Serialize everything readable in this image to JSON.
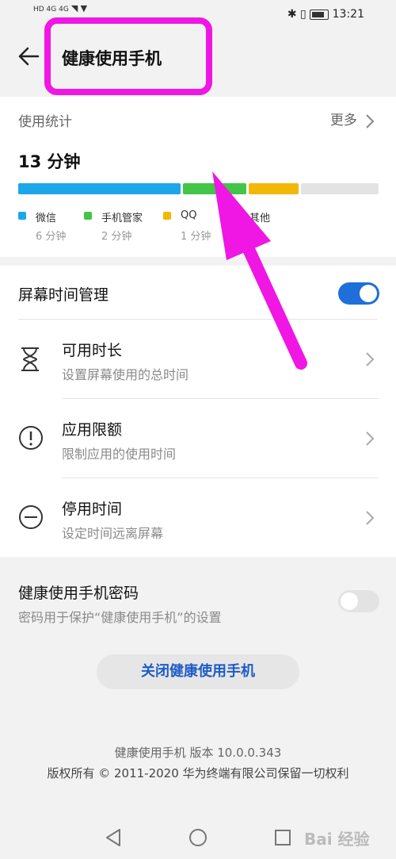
{
  "status": {
    "left_label": "HD 4G 4G",
    "time": "13:21"
  },
  "header": {
    "title": "健康使用手机"
  },
  "usage": {
    "section_label": "使用统计",
    "more_label": "更多",
    "total": "13 分钟",
    "items": [
      {
        "name": "微信",
        "value": "6 分钟",
        "minutes": 6,
        "color": "#1ba7e8"
      },
      {
        "name": "手机管家",
        "value": "2 分钟",
        "minutes": 2,
        "color": "#43c548"
      },
      {
        "name": "QQ",
        "value": "1 分钟",
        "minutes": 1,
        "color": "#f3b807"
      },
      {
        "name": "其他",
        "value": "",
        "color": "#e3e3e3"
      }
    ]
  },
  "screen_time": {
    "label": "屏幕时间管理",
    "enabled": true,
    "rows": [
      {
        "title": "可用时长",
        "subtitle": "设置屏幕使用的总时间",
        "icon": "hourglass-icon"
      },
      {
        "title": "应用限额",
        "subtitle": "限制应用的使用时间",
        "icon": "exclamation-circle-icon"
      },
      {
        "title": "停用时间",
        "subtitle": "设定时间远离屏幕",
        "icon": "minus-circle-icon"
      }
    ]
  },
  "password": {
    "title": "健康使用手机密码",
    "subtitle": "密码用于保护“健康使用手机”的设置",
    "enabled": false
  },
  "close_button": "关闭健康使用手机",
  "footer": {
    "version": "健康使用手机 版本 10.0.0.343",
    "copyright": "版权所有 © 2011-2020 华为终端有限公司保留一切权利"
  },
  "watermark": "Bai 经验",
  "colors": {
    "accent": "#1e6fd9",
    "highlight": "#f016e4"
  }
}
